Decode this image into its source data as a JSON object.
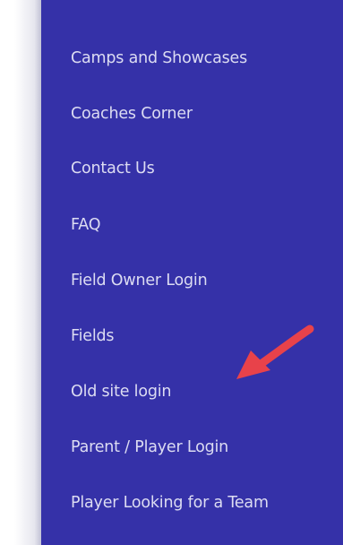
{
  "nav": {
    "items": [
      {
        "label": "Camps and Showcases"
      },
      {
        "label": "Coaches Corner"
      },
      {
        "label": "Contact Us"
      },
      {
        "label": "FAQ"
      },
      {
        "label": "Field Owner Login"
      },
      {
        "label": "Fields"
      },
      {
        "label": "Old site login"
      },
      {
        "label": "Parent / Player Login"
      },
      {
        "label": "Player Looking for a Team"
      }
    ]
  },
  "colors": {
    "panel": "#3531a8",
    "link_text": "#dcdcf2",
    "arrow": "#e8424a"
  },
  "annotation": {
    "icon": "arrow-pointing-icon"
  }
}
